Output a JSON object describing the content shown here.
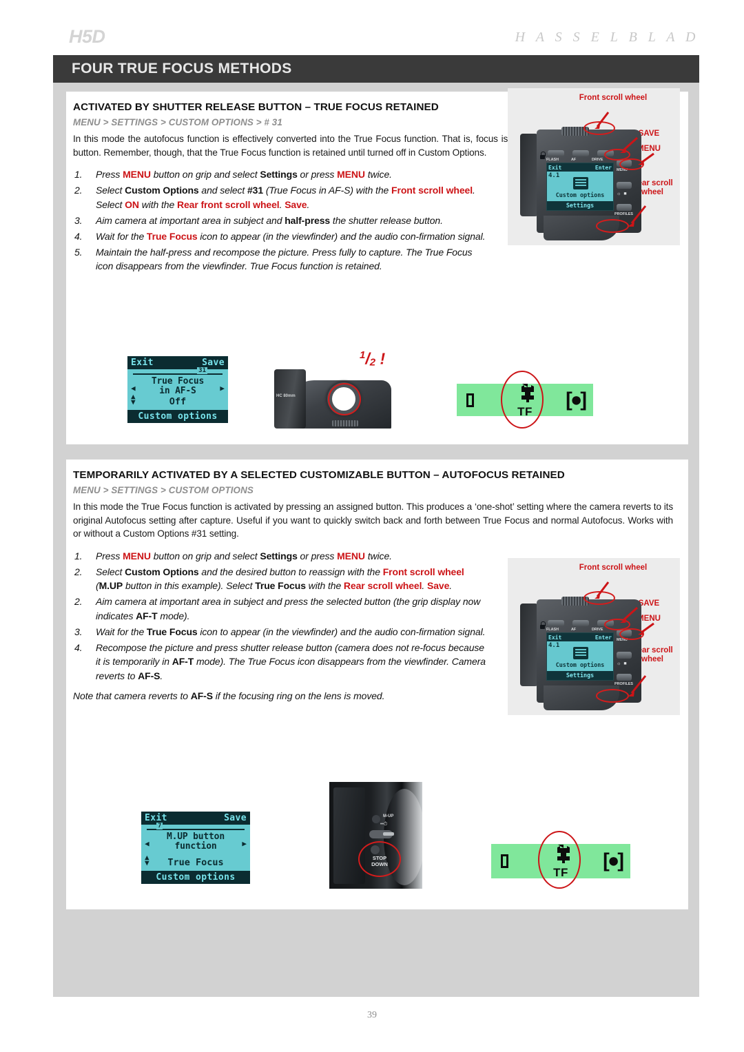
{
  "masthead": {
    "model": "H5D",
    "brand": "H A S S E L B L A D"
  },
  "title_bar": {
    "title": "FOUR TRUE FOCUS METHODS"
  },
  "colors": {
    "accent_red": "#cc1417",
    "title_bar": "#3a3a3a",
    "page_grey": "#d2d2d2",
    "lcd_cyan": "#67cbd1",
    "viewfinder_green": "#80e79b"
  },
  "section1": {
    "heading": "ACTIVATED BY SHUTTER RELEASE BUTTON – TRUE FOCUS RETAINED",
    "breadcrumb": "MENU > SETTINGS > CUSTOM OPTIONS > # 31",
    "intro": "In this mode the autofocus function is effectively converted into the True Focus function. That is, focus is set by half-pressing the shutter release button. Remember, though, that the True Focus function is retained until turned off in Custom Options.",
    "steps": [
      {
        "num": "1.",
        "text": "Press MENU button on grip and select Settings or press MENU twice."
      },
      {
        "num": "2.",
        "text": "Select Custom Options and select #31 (True Focus in AF-S) with the Front scroll wheel. Select ON with the Rear front scroll wheel. Save."
      },
      {
        "num": "3.",
        "text": "Aim camera at important area in subject and half-press the shutter release button."
      },
      {
        "num": "4.",
        "text": "Wait for the True Focus icon to appear (in the viewfinder) and the audio confirmation signal."
      },
      {
        "num": "5.",
        "text": "Maintain the half-press and recompose the picture. Press fully to capture. The True Focus icon disappears from the viewfinder. True Focus function is retained."
      }
    ],
    "lcd": {
      "exit": "Exit",
      "save": "Save",
      "index": "31",
      "title": "True Focus\nin AF-S",
      "value": "Off",
      "footer": "Custom options"
    },
    "half_press_label": "1/2 !",
    "lens_label": "HC 80mm",
    "viewfinder": {
      "tf_label": "TF"
    }
  },
  "section2": {
    "heading": "TEMPORARILY ACTIVATED BY A SELECTED CUSTOMIZABLE BUTTON – AUTOFOCUS RETAINED",
    "breadcrumb": "MENU > SETTINGS > CUSTOM OPTIONS",
    "intro": "In this mode the True Focus function is activated by pressing an assigned button. This produces a ‘one-shot’ setting where the camera reverts to its original Autofocus setting after capture. Useful if you want to quickly switch back and forth between True Focus and normal Autofocus. Works with or without a Custom Options #31 setting.",
    "steps": [
      {
        "num": "1.",
        "text": "Press MENU button on grip and select Settings or press MENU twice."
      },
      {
        "num": "2.",
        "text": "Select Custom Options and the desired button to reassign with the Front scroll wheel (M.UP button in this example). Select True Focus with the Rear scroll wheel. Save."
      },
      {
        "num": "2.",
        "text": "Aim camera at important area in subject and press the selected button (the grip display now indicates AF-T mode)."
      },
      {
        "num": "3.",
        "text": "Wait for the True Focus icon to appear (in the viewfinder) and the audio confirmation signal."
      },
      {
        "num": "4.",
        "text": "Recompose the picture and press shutter release button (camera does not refocus because it is temporarily in AF-T mode). The True Focus icon disappears from the viewfinder. Camera reverts to AF-S."
      }
    ],
    "note": "Note that camera reverts to AF-S if the focusing ring on the lens is moved.",
    "lcd": {
      "exit": "Exit",
      "save": "Save",
      "index": "7",
      "title": "M.UP button\nfunction",
      "value": "True Focus",
      "footer": "Custom options"
    },
    "button_photo": {
      "mup": "M-UP",
      "stop_down": "STOP\nDOWN"
    },
    "viewfinder": {
      "tf_label": "TF"
    }
  },
  "grip_callouts": {
    "front_scroll": "Front scroll\nwheel",
    "save": "SAVE",
    "menu": "MENU",
    "rear_scroll": "Rear\nscroll\nwheel",
    "lcd": {
      "exit": "Exit",
      "enter": "Enter",
      "num": "4.1",
      "title": "Custom options",
      "footer": "Settings"
    },
    "buttons": {
      "flash": "FLASH",
      "af": "AF",
      "drive": "DRIVE",
      "menu": "MENU",
      "profiles": "PROFILES"
    }
  },
  "footer": {
    "page_number": "39"
  }
}
